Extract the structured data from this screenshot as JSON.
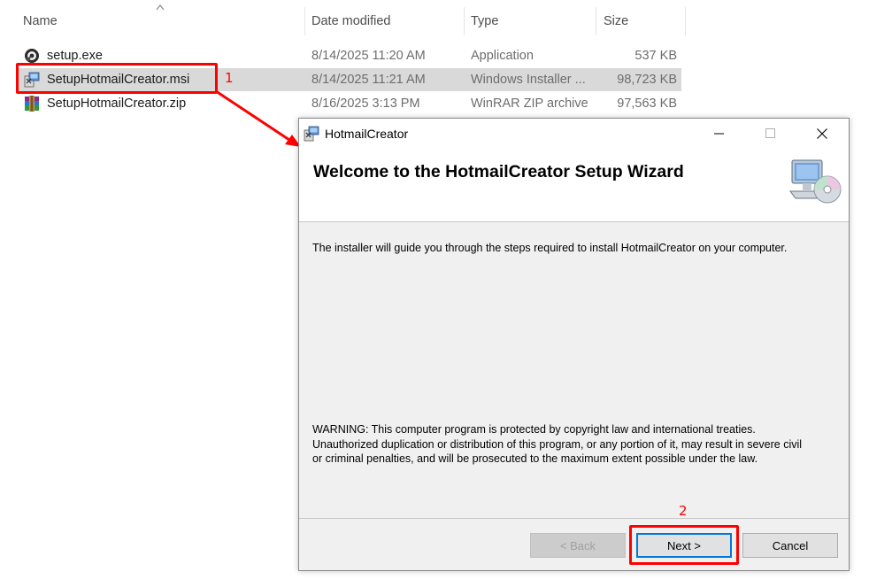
{
  "explorer": {
    "columns": {
      "name": "Name",
      "date": "Date modified",
      "type": "Type",
      "size": "Size"
    },
    "files": [
      {
        "name": "setup.exe",
        "date": "8/14/2025 11:20 AM",
        "type": "Application",
        "size": "537 KB",
        "icon": "exe-setup-icon"
      },
      {
        "name": "SetupHotmailCreator.msi",
        "date": "8/14/2025 11:21 AM",
        "type": "Windows Installer ...",
        "size": "98,723 KB",
        "icon": "msi-installer-icon",
        "selected": true
      },
      {
        "name": "SetupHotmailCreator.zip",
        "date": "8/16/2025 3:13 PM",
        "type": "WinRAR ZIP archive",
        "size": "97,563 KB",
        "icon": "winrar-zip-icon"
      }
    ]
  },
  "annotations": {
    "step1": "1",
    "step2": "2",
    "color": "#ff0000"
  },
  "dialog": {
    "title": "HotmailCreator",
    "heading": "Welcome to the HotmailCreator Setup Wizard",
    "intro": "The installer will guide you through the steps required to install HotmailCreator on your computer.",
    "warning_lines": [
      "WARNING: This computer program is protected by copyright law and international treaties.",
      "Unauthorized duplication or distribution of this program, or any portion of it, may result in severe civil",
      "or criminal penalties, and will be prosecuted to the maximum extent possible under the law."
    ],
    "buttons": {
      "back": "< Back",
      "next": "Next >",
      "cancel": "Cancel"
    },
    "accent": "#0078d7"
  }
}
